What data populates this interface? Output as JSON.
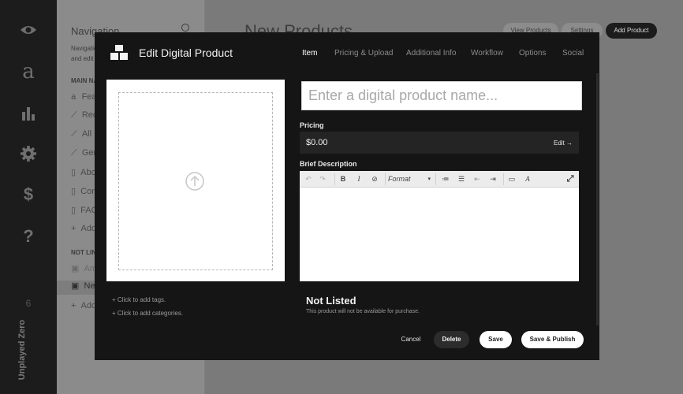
{
  "rail": {
    "icons": [
      "eye-icon",
      "amazon-icon",
      "bar-chart-icon",
      "gear-icon",
      "dollar-icon",
      "question-icon"
    ],
    "brand": "Unplayed Zero"
  },
  "bg_nav": {
    "title": "Navigation",
    "subtitle_lines": [
      "Navigation",
      "and edit"
    ],
    "main_section": "MAIN NAVIGATION",
    "main_items": [
      "Featured",
      "Recent",
      "All Products",
      "Genres",
      "About",
      "Contact",
      "FAQ",
      "Add Page"
    ],
    "other_section": "NOT LINKED",
    "other_items": [
      "Amazon",
      "New Products",
      "Add Page"
    ]
  },
  "bg_main": {
    "title": "New Products",
    "buttons": [
      "View Products",
      "Settings",
      "Add Product"
    ]
  },
  "modal": {
    "title": "Edit Digital Product",
    "tabs": [
      "Item",
      "Pricing & Upload",
      "Additional Info",
      "Workflow",
      "Options",
      "Social"
    ],
    "active_tab": "Item",
    "name_placeholder": "Enter a digital product name...",
    "pricing_label": "Pricing",
    "price_value": "$0.00",
    "price_edit": "Edit →",
    "description_label": "Brief Description",
    "editor_format_label": "Format",
    "add_tags": "+ Click to add tags.",
    "add_categories": "+ Click to add categories.",
    "status_title": "Not Listed",
    "status_desc": "This product will not be available for purchase.",
    "buttons": {
      "cancel": "Cancel",
      "delete": "Delete",
      "save": "Save",
      "save_publish": "Save & Publish"
    }
  },
  "colors": {
    "modal_bg": "#151515",
    "rail_bg": "#1c1c1c",
    "overlay_bg": "#7a7a7a",
    "active_tab": "#ffffff",
    "inactive_tab": "#8b8b8b"
  }
}
